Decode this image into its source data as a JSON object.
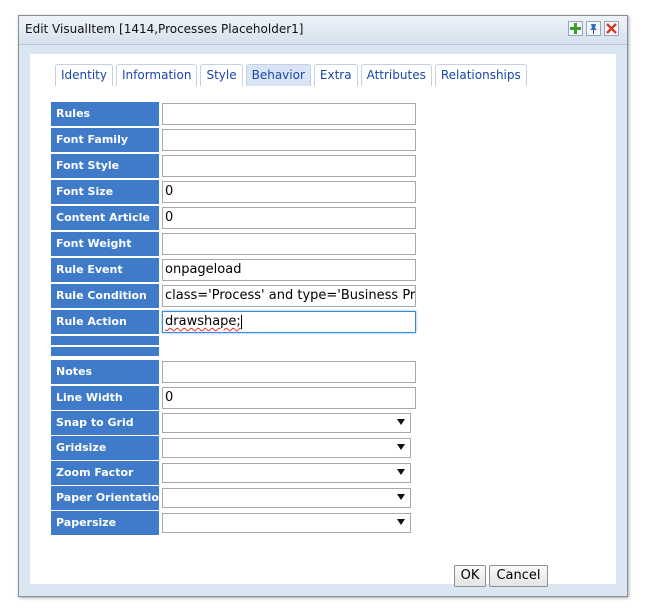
{
  "window": {
    "title": "Edit VisualItem [1414,Processes Placeholder1]",
    "icons": [
      "add-icon",
      "pin-icon",
      "close-icon"
    ]
  },
  "tabs": [
    {
      "label": "Identity",
      "active": false
    },
    {
      "label": "Information",
      "active": false
    },
    {
      "label": "Style",
      "active": false
    },
    {
      "label": "Behavior",
      "active": true
    },
    {
      "label": "Extra",
      "active": false
    },
    {
      "label": "Attributes",
      "active": false
    },
    {
      "label": "Relationships",
      "active": false
    }
  ],
  "form": {
    "rules": {
      "label": "Rules",
      "value": ""
    },
    "font_family": {
      "label": "Font Family",
      "value": ""
    },
    "font_style": {
      "label": "Font Style",
      "value": ""
    },
    "font_size": {
      "label": "Font Size",
      "value": "0"
    },
    "content_article": {
      "label": "Content Article",
      "value": "0"
    },
    "font_weight": {
      "label": "Font Weight",
      "value": ""
    },
    "rule_event": {
      "label": "Rule Event",
      "value": "onpageload"
    },
    "rule_condition": {
      "label": "Rule Condition",
      "value": "class='Process' and type='Business Pr"
    },
    "rule_action": {
      "label": "Rule Action",
      "value": "drawshape;"
    },
    "notes": {
      "label": "Notes",
      "value": ""
    },
    "line_width": {
      "label": "Line Width",
      "value": "0"
    },
    "snap_to_grid": {
      "label": "Snap to Grid",
      "value": ""
    },
    "gridsize": {
      "label": "Gridsize",
      "value": ""
    },
    "zoom_factor": {
      "label": "Zoom Factor",
      "value": ""
    },
    "paper_orientation": {
      "label": "Paper Orientation",
      "value": ""
    },
    "papersize": {
      "label": "Papersize",
      "value": ""
    }
  },
  "buttons": {
    "ok": "OK",
    "cancel": "Cancel"
  },
  "colors": {
    "label_bg": "#3f7bc9",
    "tab_text": "#1a47a8",
    "dialog_bg": "#dbe6f3"
  }
}
